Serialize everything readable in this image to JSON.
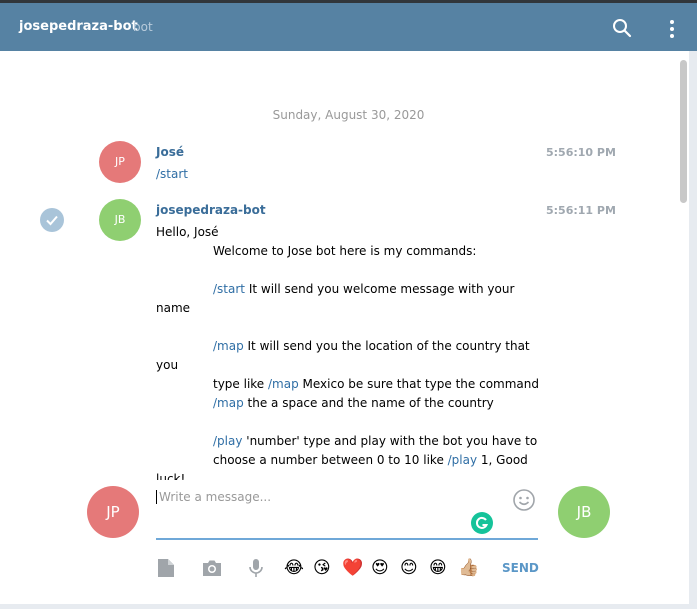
{
  "header": {
    "title": "josepedraza-bot",
    "subtitle": "bot"
  },
  "date_separator": "Sunday, August 30, 2020",
  "messages": [
    {
      "author": "José",
      "initials": "JP",
      "time": "5:56:10 PM",
      "text": "/start"
    },
    {
      "author": "josepedraza-bot",
      "initials": "JB",
      "time": "5:56:11 PM",
      "lines": {
        "l1": "Hello, José",
        "l2": "Welcome to Jose bot here is my commands:",
        "l3_cmd": "/start",
        "l3_rest": " It will send you welcome message with your",
        "l4": "name",
        "l5_cmd": "/map",
        "l5_rest": "  It will send you the location of the country that",
        "l6": "you",
        "l7_pre": "type like ",
        "l7_cmd": "/map",
        "l7_rest": " Mexico be sure that type the command",
        "l8_cmd": "/map",
        "l8_rest": " the a space and the name of the country",
        "l9_cmd": "/play",
        "l9_rest": " 'number' type and play with the bot you have to",
        "l10_pre": "choose a number between 0 to 10 like ",
        "l10_cmd": "/play",
        "l10_rest": " 1, Good",
        "l11": "luck!"
      }
    }
  ],
  "composer": {
    "placeholder": "Write a message...",
    "self_initials": "JP",
    "peer_initials": "JB",
    "send_label": "SEND",
    "emojis": [
      "😂",
      "😘",
      "❤️",
      "😍",
      "😊",
      "😁",
      "👍🏼"
    ]
  },
  "colors": {
    "header": "#5682a3",
    "accent": "#2f6ea5",
    "avatar_red": "#e57979",
    "avatar_green": "#8fcf71"
  }
}
